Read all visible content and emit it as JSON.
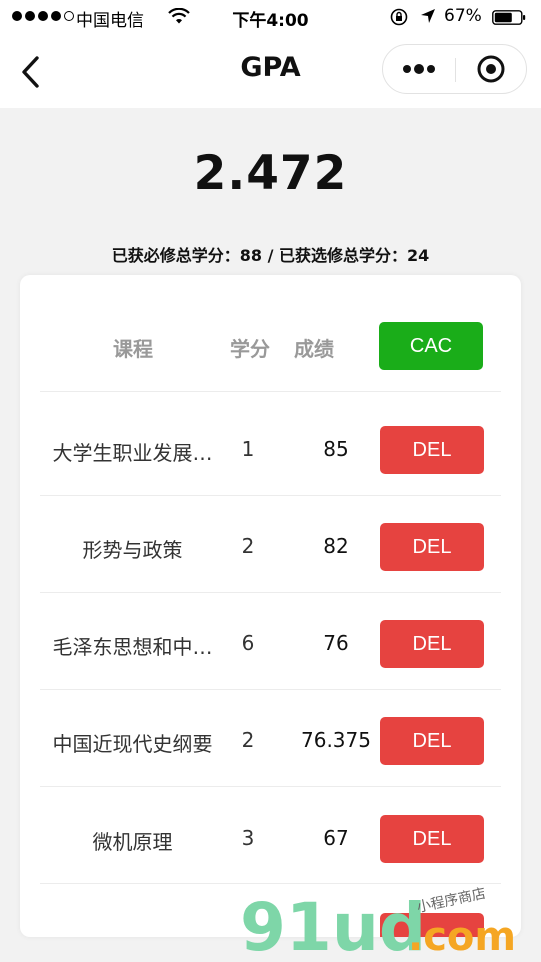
{
  "status_bar": {
    "carrier": "中国电信",
    "time": "下午4:00",
    "battery": "67%"
  },
  "nav": {
    "title": "GPA"
  },
  "summary": {
    "gpa": "2.472",
    "credits_text": "已获必修总学分：88 / 已获选修总学分：24"
  },
  "table": {
    "headers": {
      "course": "课程",
      "credit": "学分",
      "score": "成绩"
    },
    "calc_button": "CAC",
    "delete_label": "DEL",
    "rows": [
      {
        "name": "大学生职业发展…",
        "credit": "1",
        "score": "85"
      },
      {
        "name": "形势与政策",
        "credit": "2",
        "score": "82"
      },
      {
        "name": "毛泽东思想和中…",
        "credit": "6",
        "score": "76"
      },
      {
        "name": "中国近现代史纲要",
        "credit": "2",
        "score": "76.375"
      },
      {
        "name": "微机原理",
        "credit": "3",
        "score": "67"
      }
    ]
  },
  "watermark": {
    "brand": "91ud",
    "suffix": ".com",
    "tagline": "小程序商店"
  },
  "colors": {
    "accent_green": "#1aad19",
    "danger_red": "#e64340",
    "watermark_green": "#7ed6a8",
    "watermark_orange": "#f5a623"
  }
}
